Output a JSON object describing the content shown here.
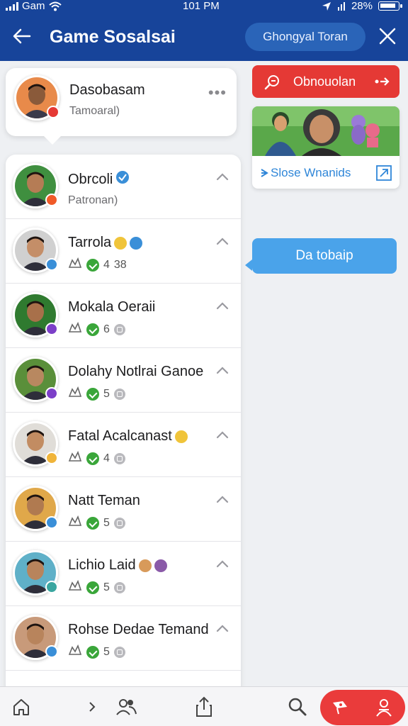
{
  "status_bar": {
    "carrier": "Gam",
    "time": "101 PM",
    "battery": "28%"
  },
  "header": {
    "title": "Game Sosalsai",
    "pill_label": "Ghongyal Toran"
  },
  "profile": {
    "name": "Dasobasam",
    "subtitle": "Tamoaral)",
    "more": "•••"
  },
  "friends": [
    {
      "name": "Obrcoli",
      "verified": true,
      "subtitle": "Patronan)",
      "stats": null,
      "presence": "#f05a28",
      "skin": "#b57c55",
      "bg": "#3f8f3f"
    },
    {
      "name": "Tarrola",
      "emoji": "#f0c43a",
      "emoji2": "#3a8fd8",
      "stats": {
        "count": "4",
        "extra": "38"
      },
      "presence": "#3a8fd8",
      "skin": "#c48e68",
      "bg": "#d0d0d0"
    },
    {
      "name": "Mokala Oeraii",
      "stats": {
        "count": "6",
        "extra": ""
      },
      "presence": "#7c3fc8",
      "skin": "#a8704a",
      "bg": "#2f7a2f"
    },
    {
      "name": "Dolahy Notlrai Ganoe",
      "stats": {
        "count": "5",
        "extra": ""
      },
      "presence": "#7c3fc8",
      "skin": "#b88860",
      "bg": "#5a8f3a"
    },
    {
      "name": "Fatal Acalcanast",
      "emoji": "#f0c43a",
      "stats": {
        "count": "4",
        "extra": ""
      },
      "presence": "#f0b43a",
      "skin": "#c28c62",
      "bg": "#e0ddd8"
    },
    {
      "name": "Natt Teman",
      "stats": {
        "count": "5",
        "extra": ""
      },
      "presence": "#3a8fd8",
      "skin": "#b07a50",
      "bg": "#e0a84a"
    },
    {
      "name": "Lichio Laid",
      "emoji": "#d89a5a",
      "emoji2": "#8a5aa8",
      "stats": {
        "count": "5",
        "extra": ""
      },
      "presence": "#3aa6a0",
      "skin": "#b8845c",
      "bg": "#5fb0c8"
    },
    {
      "name": "Rohse Dedae Temand",
      "stats": {
        "count": "5",
        "extra": ""
      },
      "presence": "#3a8fd8",
      "skin": "#b8845c",
      "bg": "#c89a7a"
    }
  ],
  "right_panel": {
    "red_button_label": "Obnouolan",
    "promo_link": "Slose Wnanids",
    "tooltip": "Da tobaip"
  },
  "colors": {
    "header_blue": "#17449a",
    "accent_red": "#e53935",
    "accent_blue": "#4aa3ea",
    "nav_red": "#ea3b3b"
  },
  "icons": {
    "nav": [
      "home-icon",
      "chevron-right-icon",
      "people-icon",
      "share-icon",
      "search-icon",
      "flag-icon",
      "user-icon"
    ]
  }
}
